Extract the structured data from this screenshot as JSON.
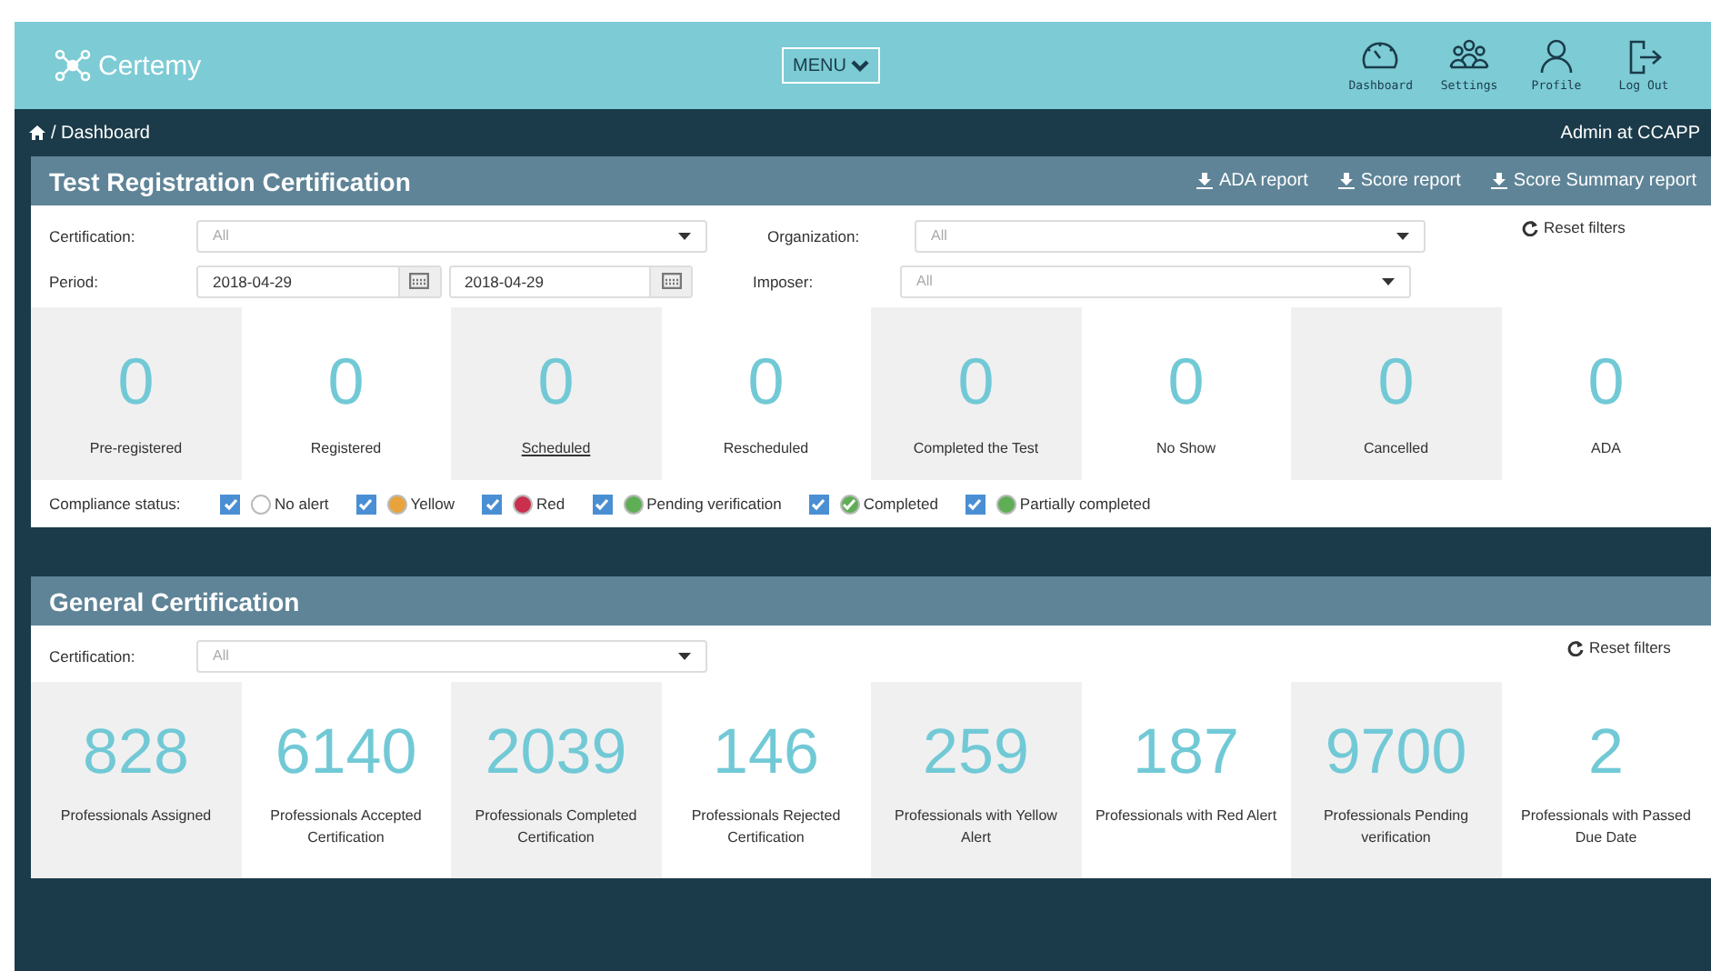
{
  "header": {
    "logo": "Certemy",
    "menu_button": "MENU",
    "nav": [
      {
        "kind": "dashboard",
        "label": "Dashboard"
      },
      {
        "kind": "settings",
        "label": "Settings"
      },
      {
        "kind": "profile",
        "label": "Profile"
      },
      {
        "kind": "logout",
        "label": "Log Out"
      }
    ]
  },
  "breadcrumb": {
    "path": "/ Dashboard",
    "user": "Admin at CCAPP"
  },
  "test_panel": {
    "title": "Test Registration Certification",
    "actions": [
      "ADA report",
      "Score report",
      "Score Summary report"
    ],
    "filters": {
      "certification": {
        "label": "Certification:",
        "value": "All"
      },
      "organization": {
        "label": "Organization:",
        "value": "All"
      },
      "period": {
        "label": "Period:",
        "from": "2018-04-29",
        "to": "2018-04-29"
      },
      "imposer": {
        "label": "Imposer:",
        "value": "All"
      },
      "reset": "Reset filters"
    },
    "stats": [
      {
        "value": "0",
        "label": "Pre-registered",
        "link": false
      },
      {
        "value": "0",
        "label": "Registered",
        "link": false
      },
      {
        "value": "0",
        "label": "Scheduled",
        "link": true
      },
      {
        "value": "0",
        "label": "Rescheduled",
        "link": false
      },
      {
        "value": "0",
        "label": "Completed the Test",
        "link": false
      },
      {
        "value": "0",
        "label": "No Show",
        "link": false
      },
      {
        "value": "0",
        "label": "Cancelled",
        "link": false
      },
      {
        "value": "0",
        "label": "ADA",
        "link": false
      }
    ],
    "compliance": {
      "label": "Compliance status:",
      "items": [
        {
          "label": "No alert",
          "checked": true,
          "color": "#ffffff",
          "kind": "dot"
        },
        {
          "label": "Yellow",
          "checked": true,
          "color": "#e8a33b",
          "kind": "dot"
        },
        {
          "label": "Red",
          "checked": true,
          "color": "#c9304d",
          "kind": "dot"
        },
        {
          "label": "Pending verification",
          "checked": true,
          "color": "#5fae55",
          "kind": "dot"
        },
        {
          "label": "Completed",
          "checked": true,
          "color": "#5fae55",
          "kind": "check"
        },
        {
          "label": "Partially completed",
          "checked": true,
          "color": "#5fae55",
          "kind": "dot"
        }
      ]
    }
  },
  "general_panel": {
    "title": "General Certification",
    "filters": {
      "certification": {
        "label": "Certification:",
        "value": "All"
      },
      "reset": "Reset filters"
    },
    "stats": [
      {
        "value": "828",
        "label": "Professionals Assigned"
      },
      {
        "value": "6140",
        "label": "Professionals Accepted Certification"
      },
      {
        "value": "2039",
        "label": "Professionals Completed Certification"
      },
      {
        "value": "146",
        "label": "Professionals Rejected Certification"
      },
      {
        "value": "259",
        "label": "Professionals with Yellow Alert"
      },
      {
        "value": "187",
        "label": "Professionals with Red Alert"
      },
      {
        "value": "9700",
        "label": "Professionals Pending verification"
      },
      {
        "value": "2",
        "label": "Professionals with Passed Due Date"
      }
    ]
  }
}
